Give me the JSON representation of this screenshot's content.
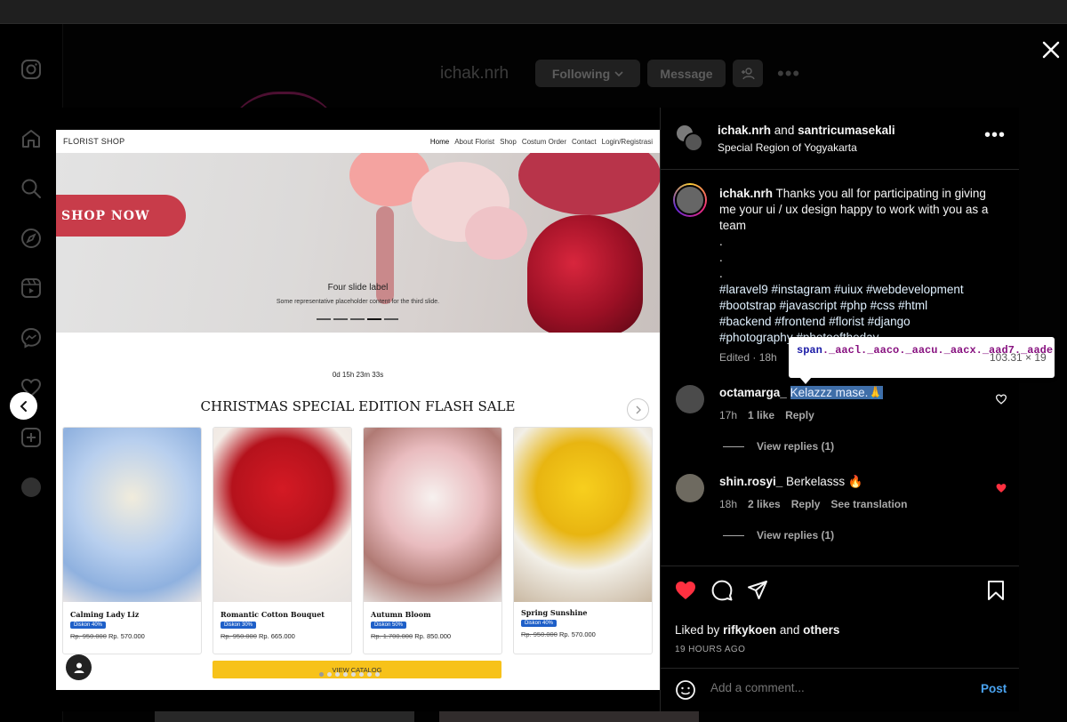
{
  "background_profile": {
    "username": "ichak.nrh",
    "following_label": "Following",
    "message_label": "Message"
  },
  "post_image": {
    "site_brand": "FLORIST SHOP",
    "nav": [
      "Home",
      "About Florist",
      "Shop",
      "Costum Order",
      "Contact",
      "Login/Registrasi"
    ],
    "shop_now": "SHOP NOW",
    "slide_label": "Four slide label",
    "slide_caption": "Some representative placeholder content for the third slide.",
    "countdown": "0d 15h 23m 33s",
    "sale_title": "CHRISTMAS SPECIAL EDITION FLASH SALE",
    "products": [
      {
        "name": "Calming Lady Liz",
        "badge": "Diskon 40%",
        "old_price": "Rp. 950.000",
        "new_price": "Rp. 570.000",
        "color": "#a9c6ea"
      },
      {
        "name": "Romantic Cotton Bouquet",
        "badge": "Diskon 30%",
        "old_price": "Rp. 950.000",
        "new_price": "Rp. 665.000",
        "color": "#c0141f"
      },
      {
        "name": "Autumn Bloom",
        "badge": "Diskon 50%",
        "old_price": "Rp. 1.700.000",
        "new_price": "Rp. 850.000",
        "color": "#e6b9b9"
      },
      {
        "name": "Spring Sunshine",
        "badge": "Diskon 40%",
        "old_price": "Rp. 950.000",
        "new_price": "Rp. 570.000",
        "color": "#f2c419"
      }
    ],
    "view_catalog": "VIEW CATALOG"
  },
  "panel": {
    "header": {
      "user1": "ichak.nrh",
      "and": "and",
      "user2": "santricumasekali",
      "location": "Special Region of Yogyakarta"
    },
    "caption": {
      "username": "ichak.nrh",
      "text": "Thanks you all for participating in giving me your ui / ux design happy to work with you as a team",
      "dots": [
        ".",
        "."
      ],
      "tags_line1": "#laravel9 #instagram #uiux #webdevelopment",
      "tags_line2": "#bootstrap #javascript #php #css #html",
      "tags_line3": "#backend #frontend #florist #django",
      "tags_line4": "#photography #photooftheday",
      "meta": "Edited · 18h"
    },
    "tooltip": {
      "selector_tag": "span",
      "selector_classes": "._aacl._aaco._aacu._aacx._aad7._aade",
      "dims": "103.31 × 19"
    },
    "comments": [
      {
        "username": "octamarga_",
        "text": "Kelazzz mase.",
        "emoji": "🙏",
        "time": "17h",
        "likes": "1 like",
        "reply": "Reply",
        "view_replies": "View replies (1)"
      },
      {
        "username": "shin.rosyi_",
        "text": "Berkelasss",
        "emoji": "🔥",
        "time": "18h",
        "likes": "2 likes",
        "reply": "Reply",
        "translation": "See translation",
        "view_replies": "View replies (1)"
      }
    ],
    "liked_by_prefix": "Liked by",
    "liked_by_user": "rifkykoen",
    "liked_by_and": "and",
    "liked_by_others": "others",
    "time_ago": "19 HOURS AGO",
    "add_comment_placeholder": "Add a comment...",
    "post_label": "Post"
  },
  "colors": {
    "accent_blue": "#4aa3f0",
    "like_red": "#ff3040",
    "highlight": "#3f6ea8"
  }
}
